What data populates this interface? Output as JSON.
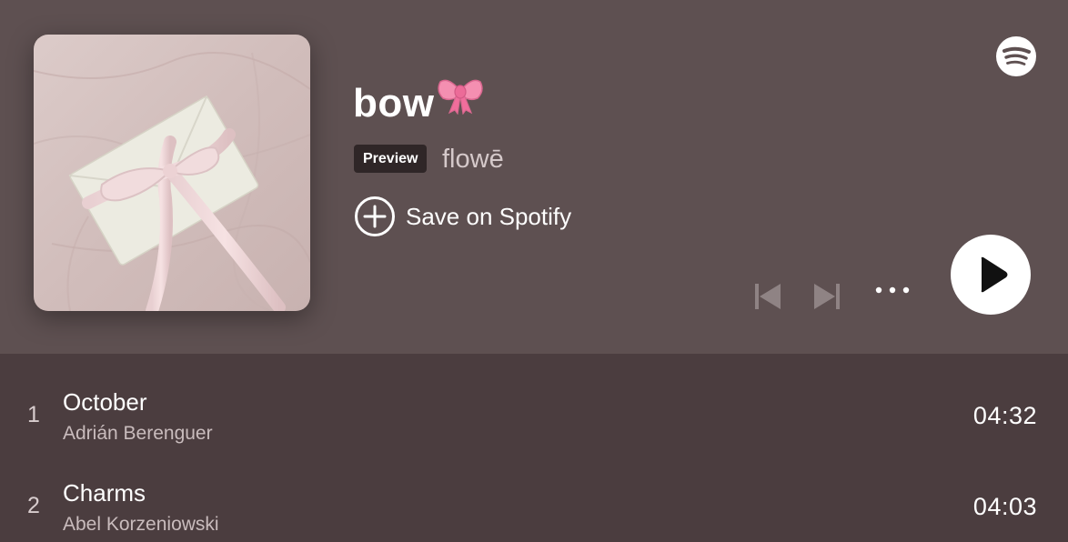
{
  "playlist": {
    "title": "bow",
    "title_emoji": "ribbon-bow",
    "badge": "Preview",
    "artist": "flowē",
    "save_label": "Save on Spotify",
    "cover_art": "white envelope tied with pink satin ribbon on pink linen"
  },
  "controls": {
    "previous": "skip-back-icon",
    "next": "skip-forward-icon",
    "more": "more-options-icon",
    "play": "play-icon"
  },
  "tracks": [
    {
      "number": "1",
      "title": "October",
      "artist": "Adrián Berenguer",
      "duration": "04:32"
    },
    {
      "number": "2",
      "title": "Charms",
      "artist": "Abel Korzeniowski",
      "duration": "04:03"
    }
  ],
  "colors": {
    "header_bg": "#5e5051",
    "list_bg": "#4b3d3f",
    "badge_bg": "#2f2627",
    "text_primary": "#ffffff",
    "text_secondary": "#c9bcbd"
  },
  "brand": "spotify-logo"
}
